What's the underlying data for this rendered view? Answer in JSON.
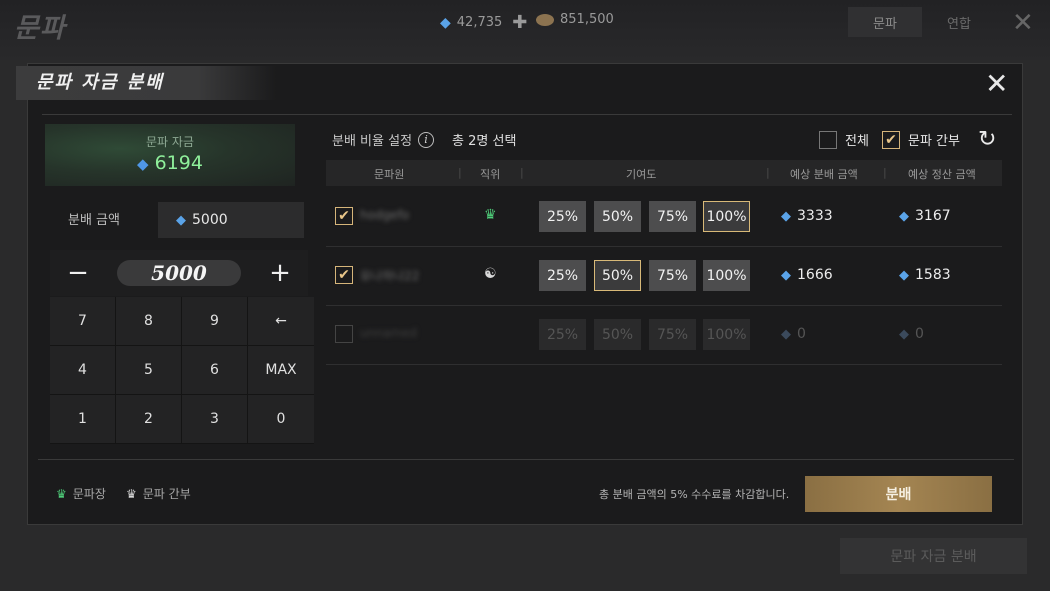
{
  "background": {
    "logo": "문파",
    "gems": "42,735",
    "gold": "851,500",
    "tabs": [
      "문파",
      "연합"
    ],
    "bottom_button": "문파 자금 분배"
  },
  "modal": {
    "title": "문파 자금 분배",
    "funds": {
      "label": "문파 자금",
      "value": "6194"
    },
    "amount": {
      "label": "분배 금액",
      "value": "5000"
    },
    "stepper": {
      "minus": "−",
      "value": "5000",
      "plus": "+"
    },
    "keypad": [
      [
        "7",
        "8",
        "9",
        "←"
      ],
      [
        "4",
        "5",
        "6",
        "MAX"
      ],
      [
        "1",
        "2",
        "3",
        "0"
      ]
    ],
    "ratio": {
      "title": "분배 비율 설정",
      "info": "i",
      "selected": "총 2명 선택"
    },
    "filters": {
      "all": "전체",
      "officer": "문파 간부"
    },
    "headers": {
      "member": "문파원",
      "rank": "직위",
      "contribution": "기여도",
      "expected_distribution": "예상 분배 금액",
      "expected_settlement": "예상 정산 금액"
    },
    "percent_options": [
      "25%",
      "50%",
      "75%",
      "100%"
    ],
    "rows": [
      {
        "name": "hodgefo",
        "checked": true,
        "rank_icon": "crown-icon",
        "selected_pct": "100%",
        "distribution": "3333",
        "settlement": "3167"
      },
      {
        "name": "유나하나22",
        "checked": true,
        "rank_icon": "yin-yang-icon",
        "selected_pct": "50%",
        "distribution": "1666",
        "settlement": "1583"
      },
      {
        "name": "unnamed",
        "checked": false,
        "rank_icon": "",
        "selected_pct": "",
        "distribution": "0",
        "settlement": "0"
      }
    ],
    "legend": {
      "leader": "문파장",
      "officer": "문파 간부"
    },
    "fee_note": "총 분배 금액의 5% 수수료를 차감합니다.",
    "distribute_button": "분배"
  }
}
